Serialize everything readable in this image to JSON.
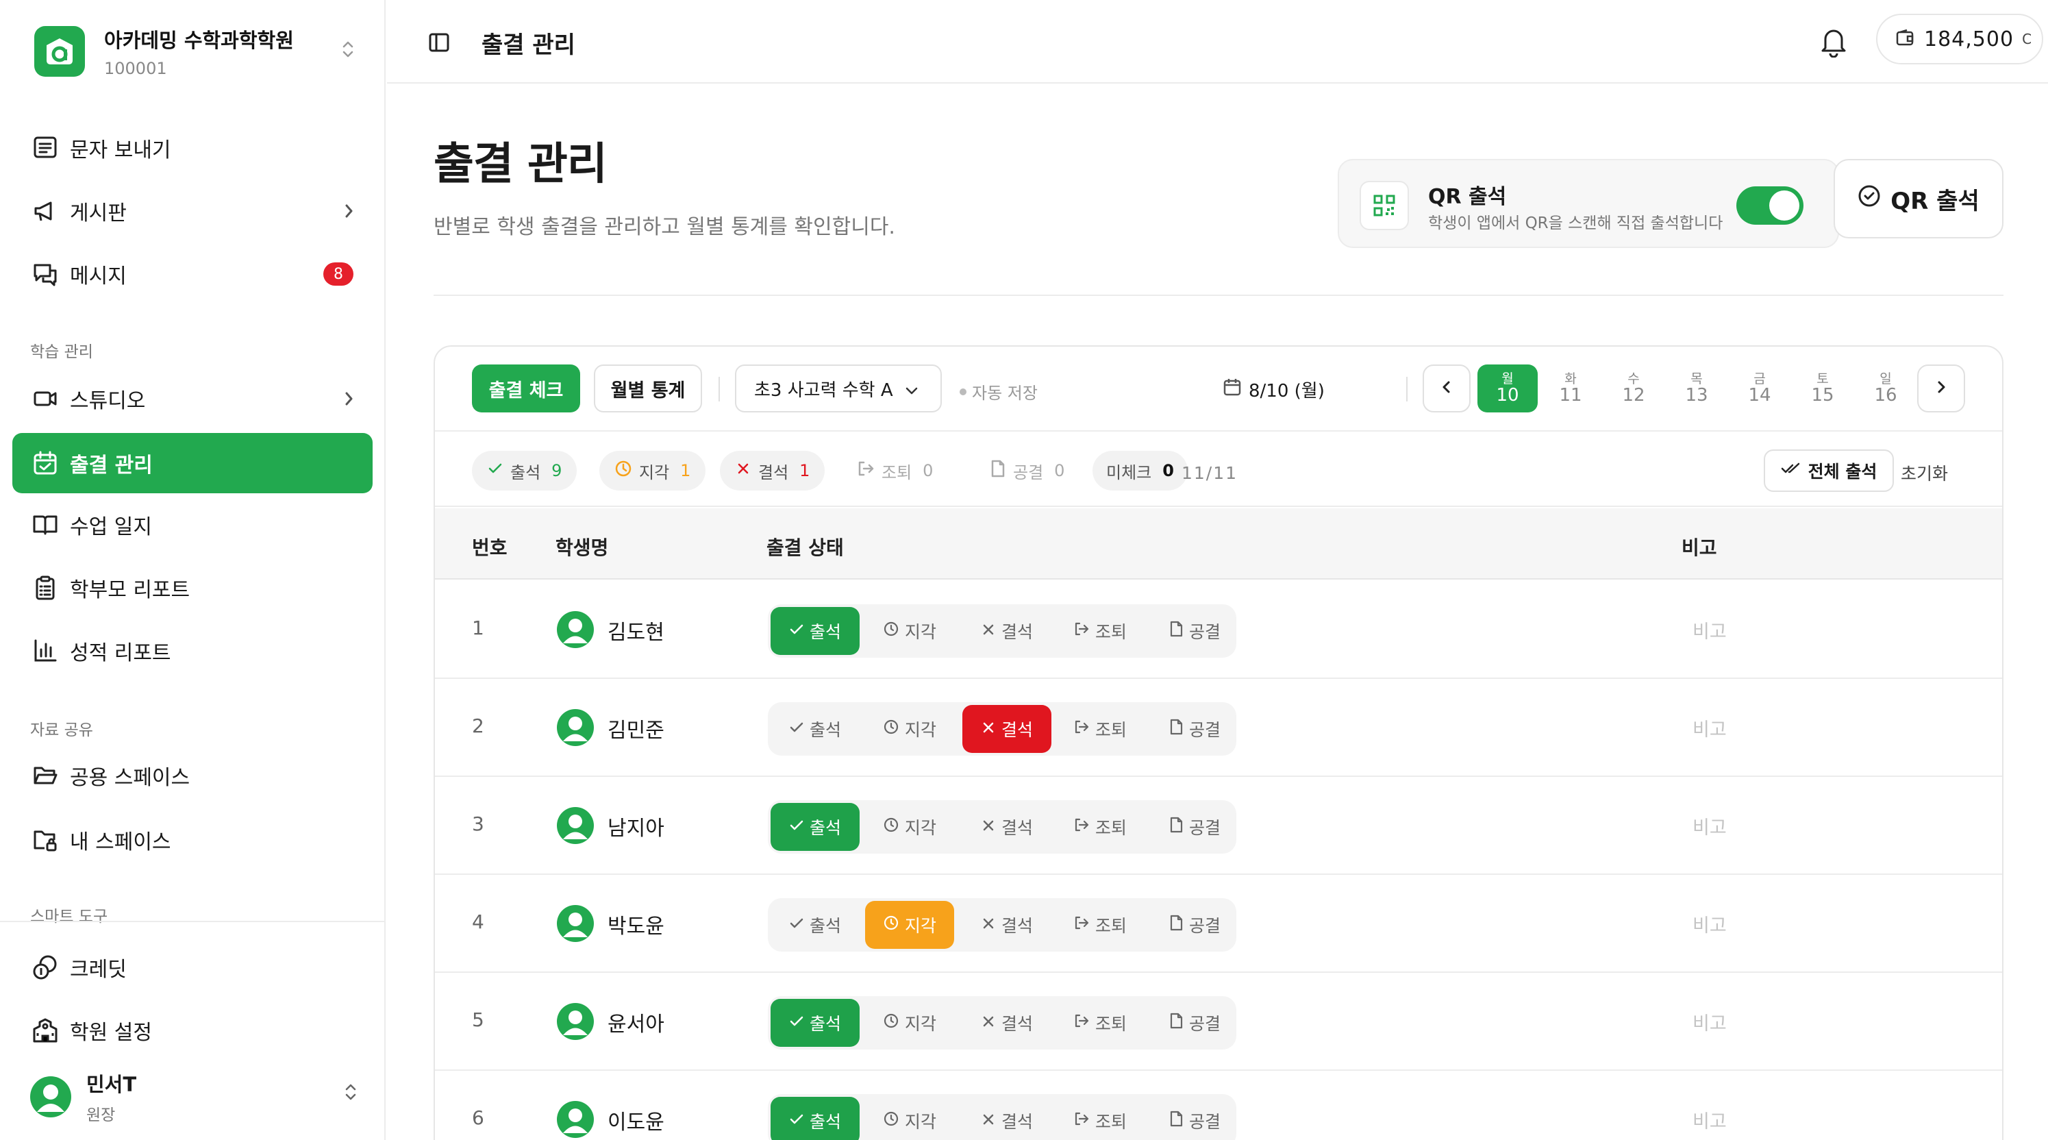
{
  "org": {
    "name": "아카데밍 수학과학학원",
    "id": "100001"
  },
  "nav": {
    "send_message": "문자 보내기",
    "board": "게시판",
    "messages": "메시지",
    "messages_badge": "8",
    "section_learning": "학습 관리",
    "studio": "스튜디오",
    "attendance": "출결 관리",
    "class_log": "수업 일지",
    "parent_report": "학부모 리포트",
    "grade_report": "성적 리포트",
    "section_share": "자료 공유",
    "shared_space": "공용 스페이스",
    "my_space": "내 스페이스",
    "section_smart": "스마트 도구",
    "credit": "크레딧",
    "academy_settings": "학원 설정"
  },
  "user": {
    "name": "민서T",
    "role": "원장"
  },
  "topbar": {
    "title": "출결 관리",
    "credit_amount": "184,500",
    "credit_unit": "C"
  },
  "page": {
    "title": "출결 관리",
    "subtitle": "반별로 학생 출결을 관리하고 월별 통계를 확인합니다."
  },
  "qr": {
    "title": "QR 출석",
    "description": "학생이 앱에서 QR을 스캔해 직접 출석합니다",
    "enabled": true,
    "button": "QR 출석"
  },
  "toolbar": {
    "tab_check": "출결 체크",
    "tab_stats": "월별 통계",
    "class_name": "초3 사고력 수학 A",
    "autosave": "자동 저장",
    "date": "8/10 (월)",
    "days": [
      {
        "dow": "월",
        "num": "10",
        "selected": true
      },
      {
        "dow": "화",
        "num": "11"
      },
      {
        "dow": "수",
        "num": "12"
      },
      {
        "dow": "목",
        "num": "13"
      },
      {
        "dow": "금",
        "num": "14"
      },
      {
        "dow": "토",
        "num": "15"
      },
      {
        "dow": "일",
        "num": "16"
      }
    ]
  },
  "summary": {
    "present_label": "출석",
    "present_count": "9",
    "late_label": "지각",
    "late_count": "1",
    "absent_label": "결석",
    "absent_count": "1",
    "early_label": "조퇴",
    "early_count": "0",
    "official_label": "공결",
    "official_count": "0",
    "unchecked_label": "미체크",
    "unchecked_count": "0",
    "progress": "11/11",
    "all_present": "전체 출석",
    "reset": "초기화"
  },
  "table": {
    "headers": {
      "no": "번호",
      "name": "학생명",
      "status": "출결 상태",
      "note": "비고"
    },
    "status_labels": {
      "present": "출석",
      "late": "지각",
      "absent": "결석",
      "early": "조퇴",
      "official": "공결"
    },
    "note_placeholder": "비고",
    "rows": [
      {
        "no": "1",
        "name": "김도현",
        "status": "present"
      },
      {
        "no": "2",
        "name": "김민준",
        "status": "absent"
      },
      {
        "no": "3",
        "name": "남지아",
        "status": "present"
      },
      {
        "no": "4",
        "name": "박도윤",
        "status": "late"
      },
      {
        "no": "5",
        "name": "윤서아",
        "status": "present"
      },
      {
        "no": "6",
        "name": "이도윤",
        "status": "present"
      }
    ]
  },
  "colors": {
    "accent": "#22a94f",
    "late": "#f7a21b",
    "absent": "#e0161f",
    "badge": "#e5202b"
  }
}
